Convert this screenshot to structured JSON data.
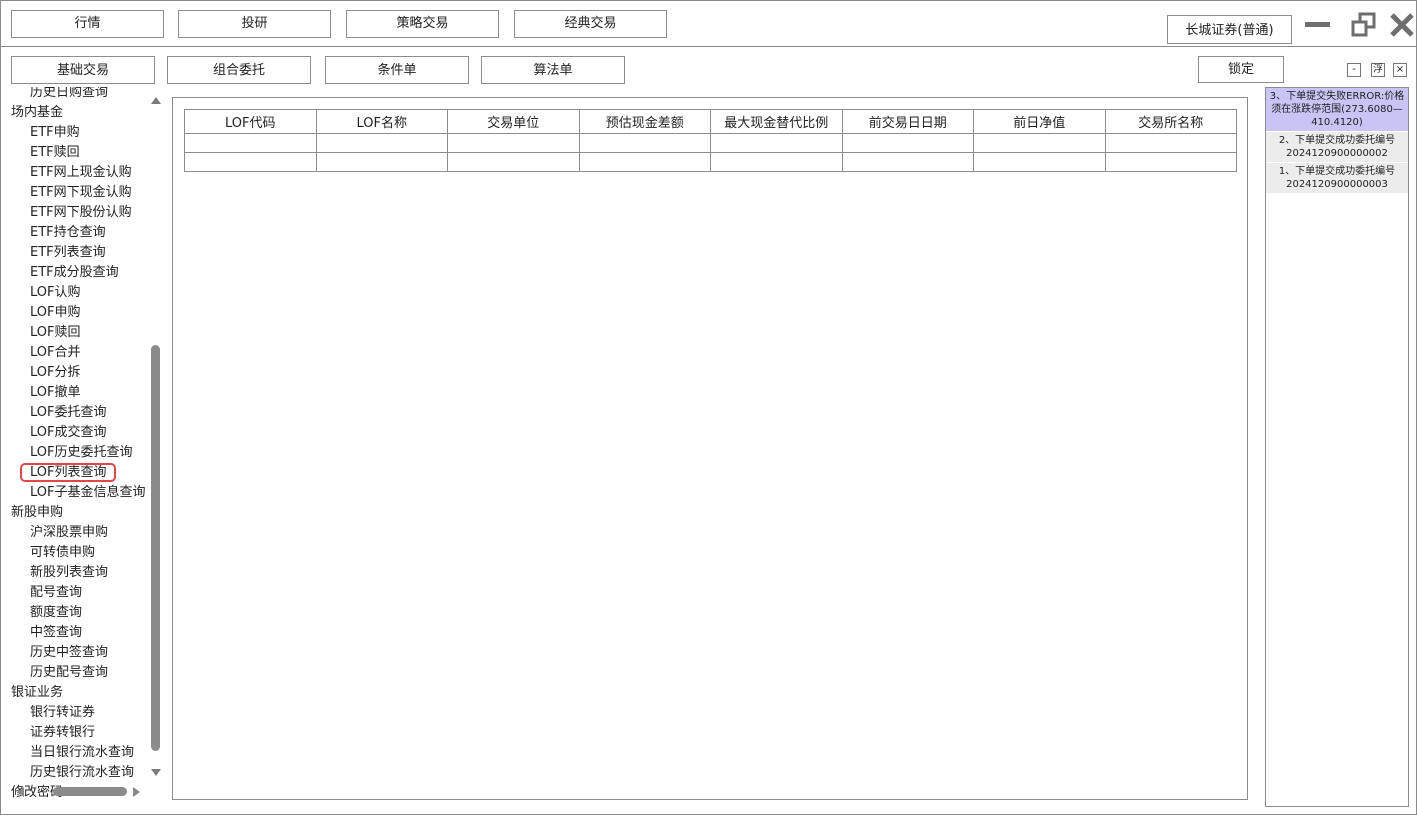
{
  "top_nav": [
    "行情",
    "投研",
    "策略交易",
    "经典交易"
  ],
  "broker": "长城证券(普通)",
  "sub_tabs": [
    "基础交易",
    "组合委托",
    "条件单",
    "算法单"
  ],
  "lock_label": "锁定",
  "mini_buttons": [
    "-",
    "浮",
    "×"
  ],
  "tree": [
    {
      "label": "历史日购查询",
      "level": "child"
    },
    {
      "label": "场内基金",
      "level": "group"
    },
    {
      "label": "ETF申购",
      "level": "child"
    },
    {
      "label": "ETF赎回",
      "level": "child"
    },
    {
      "label": "ETF网上现金认购",
      "level": "child"
    },
    {
      "label": "ETF网下现金认购",
      "level": "child"
    },
    {
      "label": "ETF网下股份认购",
      "level": "child"
    },
    {
      "label": "ETF持仓查询",
      "level": "child"
    },
    {
      "label": "ETF列表查询",
      "level": "child"
    },
    {
      "label": "ETF成分股查询",
      "level": "child"
    },
    {
      "label": "LOF认购",
      "level": "child"
    },
    {
      "label": "LOF申购",
      "level": "child"
    },
    {
      "label": "LOF赎回",
      "level": "child"
    },
    {
      "label": "LOF合并",
      "level": "child"
    },
    {
      "label": "LOF分拆",
      "level": "child"
    },
    {
      "label": "LOF撤单",
      "level": "child"
    },
    {
      "label": "LOF委托查询",
      "level": "child"
    },
    {
      "label": "LOF成交查询",
      "level": "child"
    },
    {
      "label": "LOF历史委托查询",
      "level": "child"
    },
    {
      "label": "LOF列表查询",
      "level": "child",
      "selected": true
    },
    {
      "label": "LOF子基金信息查询",
      "level": "child"
    },
    {
      "label": "新股申购",
      "level": "group"
    },
    {
      "label": "沪深股票申购",
      "level": "child"
    },
    {
      "label": "可转债申购",
      "level": "child"
    },
    {
      "label": "新股列表查询",
      "level": "child"
    },
    {
      "label": "配号查询",
      "level": "child"
    },
    {
      "label": "额度查询",
      "level": "child"
    },
    {
      "label": "中签查询",
      "level": "child"
    },
    {
      "label": "历史中签查询",
      "level": "child"
    },
    {
      "label": "历史配号查询",
      "level": "child"
    },
    {
      "label": "银证业务",
      "level": "group"
    },
    {
      "label": "银行转证券",
      "level": "child"
    },
    {
      "label": "证券转银行",
      "level": "child"
    },
    {
      "label": "当日银行流水查询",
      "level": "child"
    },
    {
      "label": "历史银行流水查询",
      "level": "child"
    },
    {
      "label": "修改密码",
      "level": "group"
    }
  ],
  "table": {
    "columns": [
      "LOF代码",
      "LOF名称",
      "交易单位",
      "预估现金差额",
      "最大现金替代比例",
      "前交易日日期",
      "前日净值",
      "交易所名称"
    ],
    "rows": [
      [
        "",
        "",
        "",
        "",
        "",
        "",
        "",
        ""
      ],
      [
        "",
        "",
        "",
        "",
        "",
        "",
        "",
        ""
      ]
    ]
  },
  "messages": [
    {
      "text": "3、下单提交失败ERROR:价格须在涨跌停范围(273.6080—410.4120)",
      "type": "error"
    },
    {
      "text": "2、下单提交成功委托编号2024120900000002",
      "type": "ok"
    },
    {
      "text": "1、下单提交成功委托编号2024120900000003",
      "type": "ok"
    }
  ],
  "colors": {
    "error_bg": "#c9c4f5",
    "ok_bg": "#ececec",
    "selected_outline": "#e04848"
  }
}
